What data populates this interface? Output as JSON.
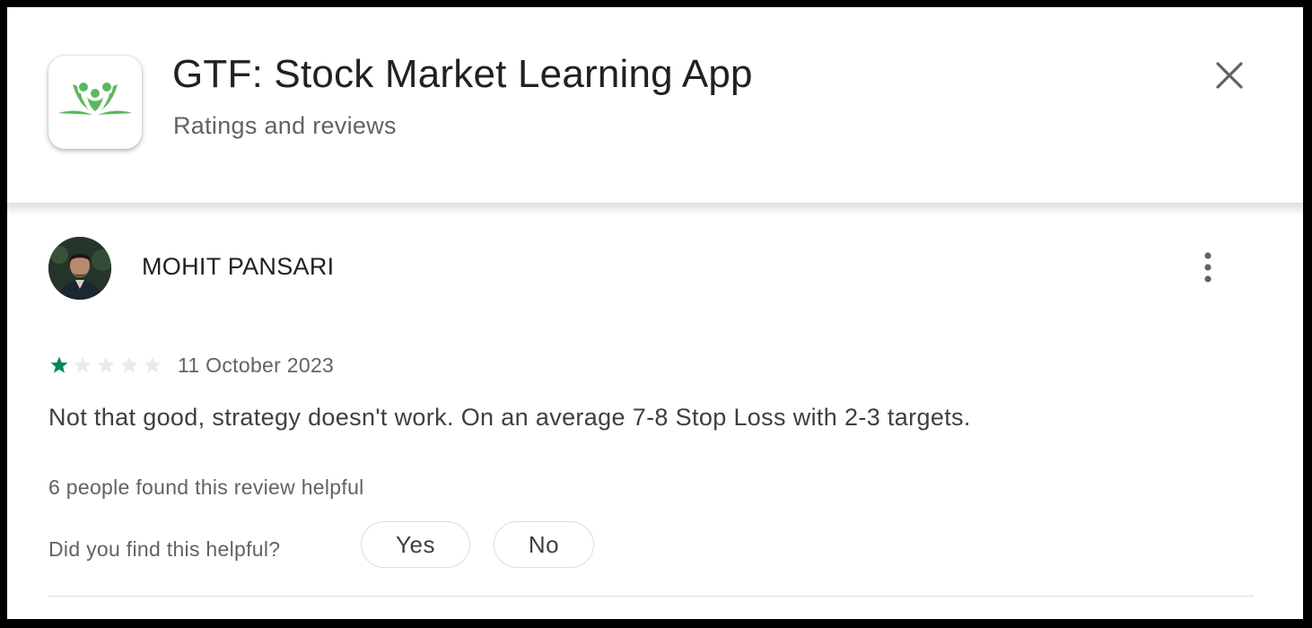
{
  "header": {
    "app_title": "GTF: Stock Market Learning App",
    "subtitle": "Ratings and reviews",
    "app_icon": "gtf-logo-icon",
    "close_icon": "close-icon"
  },
  "review": {
    "author": "MOHIT PANSARI",
    "avatar": "avatar",
    "more_icon": "more-vert-icon",
    "rating": 1,
    "rating_max": 5,
    "date": "11 October 2023",
    "text": "Not that good, strategy doesn't work. On an average 7-8 Stop Loss with 2-3 targets.",
    "helpful_count_text": "6 people found this review helpful",
    "helpful_question": "Did you find this helpful?",
    "yes_label": "Yes",
    "no_label": "No"
  },
  "colors": {
    "star_filled": "#01875f",
    "star_empty": "#e8eaed",
    "logo_green": "#5cb85c",
    "text_primary": "#202124",
    "text_secondary": "#5f6368"
  }
}
